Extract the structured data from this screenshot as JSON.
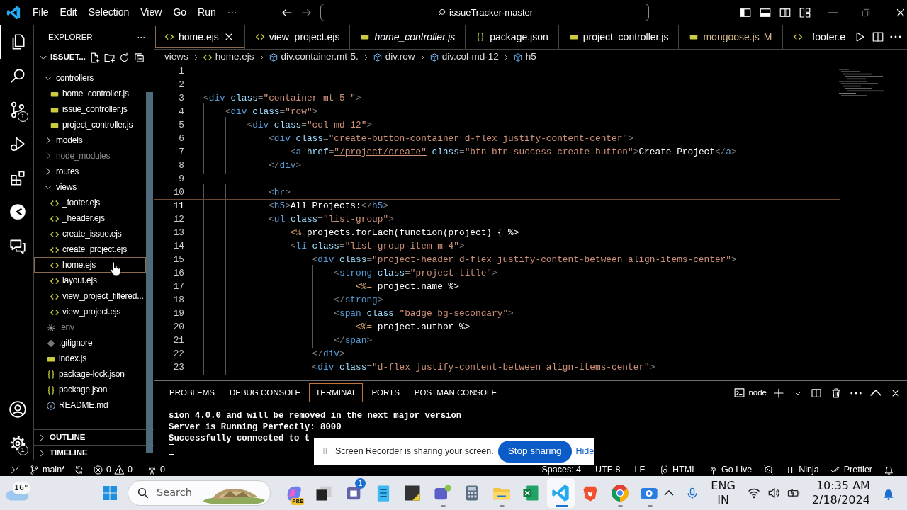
{
  "title_bar": {
    "menus": [
      "File",
      "Edit",
      "Selection",
      "View",
      "Go",
      "Run",
      "···"
    ],
    "command_center": "issueTracker-master"
  },
  "activity_bar": {
    "items": [
      {
        "kind": "files",
        "selected": true
      },
      {
        "kind": "search",
        "selected": false
      },
      {
        "kind": "source-control",
        "selected": false,
        "badge": "1"
      },
      {
        "kind": "run-debug",
        "selected": false
      },
      {
        "kind": "extensions",
        "selected": false
      },
      {
        "kind": "circle-app",
        "selected": false
      },
      {
        "kind": "chat",
        "selected": false
      }
    ],
    "bottom": [
      {
        "kind": "account"
      },
      {
        "kind": "settings",
        "badge": "1"
      }
    ]
  },
  "sidebar": {
    "title": "EXPLORER",
    "more": "···",
    "root": "ISSUET...",
    "tree": [
      {
        "label": "controllers",
        "kind": "folder",
        "expanded": true,
        "ignored": false,
        "selected": false,
        "children": [
          {
            "label": "home_controller.js",
            "kind": "js",
            "ignored": false,
            "selected": false
          },
          {
            "label": "issue_controller.js",
            "kind": "js",
            "ignored": false,
            "selected": false
          },
          {
            "label": "project_controller.js",
            "kind": "js",
            "ignored": false,
            "selected": false
          }
        ]
      },
      {
        "label": "models",
        "kind": "folder",
        "expanded": false,
        "ignored": false,
        "selected": false
      },
      {
        "label": "node_modules",
        "kind": "folder",
        "expanded": false,
        "ignored": true,
        "selected": false
      },
      {
        "label": "routes",
        "kind": "folder",
        "expanded": false,
        "ignored": false,
        "selected": false
      },
      {
        "label": "views",
        "kind": "folder",
        "expanded": true,
        "ignored": false,
        "selected": false,
        "children": [
          {
            "label": "_footer.ejs",
            "kind": "ejs",
            "ignored": false,
            "selected": false
          },
          {
            "label": "_header.ejs",
            "kind": "ejs",
            "ignored": false,
            "selected": false
          },
          {
            "label": "create_issue.ejs",
            "kind": "ejs",
            "ignored": false,
            "selected": false
          },
          {
            "label": "create_project.ejs",
            "kind": "ejs",
            "ignored": false,
            "selected": false
          },
          {
            "label": "home.ejs",
            "kind": "ejs",
            "ignored": false,
            "selected": true
          },
          {
            "label": "layout.ejs",
            "kind": "ejs",
            "ignored": false,
            "selected": false
          },
          {
            "label": "view_project_filtered...",
            "kind": "ejs",
            "ignored": false,
            "selected": false
          },
          {
            "label": "view_project.ejs",
            "kind": "ejs",
            "ignored": false,
            "selected": false
          }
        ]
      },
      {
        "label": ".env",
        "kind": "env",
        "ignored": true,
        "selected": false
      },
      {
        "label": ".gitignore",
        "kind": "git",
        "ignored": false,
        "selected": false
      },
      {
        "label": "index.js",
        "kind": "js",
        "ignored": false,
        "selected": false
      },
      {
        "label": "package-lock.json",
        "kind": "json",
        "ignored": false,
        "selected": false
      },
      {
        "label": "package.json",
        "kind": "json",
        "ignored": false,
        "selected": false
      },
      {
        "label": "README.md",
        "kind": "info",
        "ignored": false,
        "selected": false
      }
    ],
    "sections": [
      {
        "label": "OUTLINE",
        "expanded": false
      },
      {
        "label": "TIMELINE",
        "expanded": false
      }
    ]
  },
  "tabs": [
    {
      "label": "home.ejs",
      "kind": "ejs",
      "selected": true,
      "preview": false
    },
    {
      "label": "view_project.ejs",
      "kind": "ejs",
      "selected": false,
      "preview": false
    },
    {
      "label": "home_controller.js",
      "kind": "js",
      "selected": false,
      "preview": true
    },
    {
      "label": "package.json",
      "kind": "json",
      "selected": false,
      "preview": false
    },
    {
      "label": "project_controller.js",
      "kind": "js",
      "selected": false,
      "preview": false
    },
    {
      "label": "mongoose.js",
      "kind": "js",
      "selected": false,
      "preview": false,
      "status": "M"
    },
    {
      "label": "_footer.e",
      "kind": "ejs",
      "selected": false,
      "preview": false
    }
  ],
  "breadcrumbs": [
    {
      "label": "views",
      "kind": "folder"
    },
    {
      "label": "home.ejs",
      "kind": "ejs"
    },
    {
      "label": "div.container.mt-5.",
      "kind": "element"
    },
    {
      "label": "div.row",
      "kind": "element"
    },
    {
      "label": "div.col-md-12",
      "kind": "element"
    },
    {
      "label": "h5",
      "kind": "element"
    }
  ],
  "code": [
    {
      "number": "1",
      "current": false
    },
    {
      "number": "2",
      "current": false
    },
    {
      "number": "3",
      "current": false,
      "tokens": [
        {
          "kind": "punct",
          "text": "<"
        },
        {
          "kind": "tag",
          "text": "div"
        },
        {
          "kind": "attr",
          "text": " class"
        },
        {
          "kind": "punct",
          "text": "="
        },
        {
          "kind": "str",
          "text": "\"container mt-5 \""
        },
        {
          "kind": "punct",
          "text": ">"
        }
      ]
    },
    {
      "number": "4",
      "current": false,
      "tokens": [
        {
          "kind": "punct",
          "text": "    <"
        },
        {
          "kind": "tag",
          "text": "div"
        },
        {
          "kind": "attr",
          "text": " class"
        },
        {
          "kind": "punct",
          "text": "="
        },
        {
          "kind": "str",
          "text": "\"row\""
        },
        {
          "kind": "punct",
          "text": ">"
        }
      ]
    },
    {
      "number": "5",
      "current": false,
      "tokens": [
        {
          "kind": "punct",
          "text": "        <"
        },
        {
          "kind": "tag",
          "text": "div"
        },
        {
          "kind": "attr",
          "text": " class"
        },
        {
          "kind": "punct",
          "text": "="
        },
        {
          "kind": "str",
          "text": "\"col-md-12\""
        },
        {
          "kind": "punct",
          "text": ">"
        }
      ]
    },
    {
      "number": "6",
      "current": false,
      "tokens": [
        {
          "kind": "punct",
          "text": "            <"
        },
        {
          "kind": "tag",
          "text": "div"
        },
        {
          "kind": "attr",
          "text": " class"
        },
        {
          "kind": "punct",
          "text": "="
        },
        {
          "kind": "str",
          "text": "\"create-button-container d-flex justify-content-center\""
        },
        {
          "kind": "punct",
          "text": ">"
        }
      ]
    },
    {
      "number": "7",
      "current": false,
      "tokens": [
        {
          "kind": "punct",
          "text": "                <"
        },
        {
          "kind": "tag",
          "text": "a"
        },
        {
          "kind": "attr",
          "text": " href"
        },
        {
          "kind": "punct",
          "text": "="
        },
        {
          "kind": "link",
          "text": "\"/project/create\""
        },
        {
          "kind": "attr",
          "text": " class"
        },
        {
          "kind": "punct",
          "text": "="
        },
        {
          "kind": "str",
          "text": "\"btn btn-success create-button\""
        },
        {
          "kind": "punct",
          "text": ">"
        },
        {
          "kind": "text",
          "text": "Create Project"
        },
        {
          "kind": "punct",
          "text": "</"
        },
        {
          "kind": "tag",
          "text": "a"
        },
        {
          "kind": "punct",
          "text": ">"
        }
      ]
    },
    {
      "number": "8",
      "current": false,
      "tokens": [
        {
          "kind": "punct",
          "text": "            </"
        },
        {
          "kind": "tag",
          "text": "div"
        },
        {
          "kind": "punct",
          "text": ">"
        }
      ]
    },
    {
      "number": "9",
      "current": false
    },
    {
      "number": "10",
      "current": false,
      "tokens": [
        {
          "kind": "punct",
          "text": "            <"
        },
        {
          "kind": "tag",
          "text": "hr"
        },
        {
          "kind": "punct",
          "text": ">"
        }
      ]
    },
    {
      "number": "11",
      "current": true,
      "tokens": [
        {
          "kind": "punct",
          "text": "            <"
        },
        {
          "kind": "tag",
          "text": "h5"
        },
        {
          "kind": "punct",
          "text": ">"
        },
        {
          "kind": "text",
          "text": "All Projects:"
        },
        {
          "kind": "punct",
          "text": "</"
        },
        {
          "kind": "tag",
          "text": "h5"
        },
        {
          "kind": "punct",
          "text": ">"
        }
      ]
    },
    {
      "number": "12",
      "current": false,
      "tokens": [
        {
          "kind": "punct",
          "text": "            <"
        },
        {
          "kind": "tag",
          "text": "ul"
        },
        {
          "kind": "attr",
          "text": " class"
        },
        {
          "kind": "punct",
          "text": "="
        },
        {
          "kind": "str",
          "text": "\"list-group\""
        },
        {
          "kind": "punct",
          "text": ">"
        }
      ]
    },
    {
      "number": "13",
      "current": false,
      "tokens": [
        {
          "kind": "ejs",
          "text": "                <%"
        },
        {
          "kind": "text",
          "text": " projects.forEach(function(project) { %>"
        }
      ]
    },
    {
      "number": "14",
      "current": false,
      "tokens": [
        {
          "kind": "punct",
          "text": "                <"
        },
        {
          "kind": "tag",
          "text": "li"
        },
        {
          "kind": "attr",
          "text": " class"
        },
        {
          "kind": "punct",
          "text": "="
        },
        {
          "kind": "str",
          "text": "\"list-group-item m-4\""
        },
        {
          "kind": "punct",
          "text": ">"
        }
      ]
    },
    {
      "number": "15",
      "current": false,
      "tokens": [
        {
          "kind": "punct",
          "text": "                    <"
        },
        {
          "kind": "tag",
          "text": "div"
        },
        {
          "kind": "attr",
          "text": " class"
        },
        {
          "kind": "punct",
          "text": "="
        },
        {
          "kind": "str",
          "text": "\"project-header d-flex justify-content-between align-items-center\""
        },
        {
          "kind": "punct",
          "text": ">"
        }
      ]
    },
    {
      "number": "16",
      "current": false,
      "tokens": [
        {
          "kind": "punct",
          "text": "                        <"
        },
        {
          "kind": "tag",
          "text": "strong"
        },
        {
          "kind": "attr",
          "text": " class"
        },
        {
          "kind": "punct",
          "text": "="
        },
        {
          "kind": "str",
          "text": "\"project-title\""
        },
        {
          "kind": "punct",
          "text": ">"
        }
      ]
    },
    {
      "number": "17",
      "current": false,
      "tokens": [
        {
          "kind": "ejs",
          "text": "                            <%="
        },
        {
          "kind": "text",
          "text": " project.name %>"
        }
      ]
    },
    {
      "number": "18",
      "current": false,
      "tokens": [
        {
          "kind": "punct",
          "text": "                        </"
        },
        {
          "kind": "tag",
          "text": "strong"
        },
        {
          "kind": "punct",
          "text": ">"
        }
      ]
    },
    {
      "number": "19",
      "current": false,
      "tokens": [
        {
          "kind": "punct",
          "text": "                        <"
        },
        {
          "kind": "tag",
          "text": "span"
        },
        {
          "kind": "attr",
          "text": " class"
        },
        {
          "kind": "punct",
          "text": "="
        },
        {
          "kind": "str",
          "text": "\"badge bg-secondary\""
        },
        {
          "kind": "punct",
          "text": ">"
        }
      ]
    },
    {
      "number": "20",
      "current": false,
      "tokens": [
        {
          "kind": "ejs",
          "text": "                            <%="
        },
        {
          "kind": "text",
          "text": " project.author %>"
        }
      ]
    },
    {
      "number": "21",
      "current": false,
      "tokens": [
        {
          "kind": "punct",
          "text": "                        </"
        },
        {
          "kind": "tag",
          "text": "span"
        },
        {
          "kind": "punct",
          "text": ">"
        }
      ]
    },
    {
      "number": "22",
      "current": false,
      "tokens": [
        {
          "kind": "punct",
          "text": "                    </"
        },
        {
          "kind": "tag",
          "text": "div"
        },
        {
          "kind": "punct",
          "text": ">"
        }
      ]
    },
    {
      "number": "23",
      "current": false,
      "tokens": [
        {
          "kind": "punct",
          "text": "                    <"
        },
        {
          "kind": "tag",
          "text": "div"
        },
        {
          "kind": "attr",
          "text": " class"
        },
        {
          "kind": "punct",
          "text": "="
        },
        {
          "kind": "str",
          "text": "\"d-flex justify-content-between align-items-center\""
        },
        {
          "kind": "punct",
          "text": ">"
        }
      ]
    }
  ],
  "panel": {
    "tabs": [
      {
        "label": "PROBLEMS",
        "selected": false
      },
      {
        "label": "DEBUG CONSOLE",
        "selected": false
      },
      {
        "label": "TERMINAL",
        "selected": true
      },
      {
        "label": "PORTS",
        "selected": false
      },
      {
        "label": "POSTMAN CONSOLE",
        "selected": false
      }
    ],
    "terminal_name": "node",
    "terminal_lines": [
      "sion 4.0.0 and will be removed in the next major version",
      "Server is Running Perfectly: 8000",
      "Successfully connected to t"
    ]
  },
  "share_popup": {
    "message": "Screen Recorder is sharing your screen.",
    "stop": "Stop sharing",
    "hide": "Hide"
  },
  "status_bar": {
    "branch": "main*",
    "errors": "0",
    "warnings": "0",
    "ports": "0",
    "right": [
      {
        "kind": "text",
        "label": "Spaces: 4"
      },
      {
        "kind": "text",
        "label": "UTF-8"
      },
      {
        "kind": "text",
        "label": "LF"
      },
      {
        "kind": "braces",
        "label": "HTML"
      },
      {
        "kind": "broadcast",
        "label": "Go Live"
      },
      {
        "kind": "copilot-off"
      },
      {
        "kind": "pause",
        "label": "Ninja"
      },
      {
        "kind": "checks",
        "label": "Prettier"
      },
      {
        "kind": "bell"
      }
    ]
  },
  "taskbar": {
    "weather": "16°",
    "search": "Search",
    "apps": [
      {
        "kind": "copilot",
        "badge": "PRE",
        "running": false,
        "active": false
      },
      {
        "kind": "task-view",
        "running": false,
        "active": false
      },
      {
        "kind": "teams",
        "badge": "1",
        "running": false,
        "active": false
      },
      {
        "kind": "notepad",
        "running": false,
        "active": false
      },
      {
        "kind": "sticky",
        "running": false,
        "active": false
      },
      {
        "kind": "teams-work",
        "running": true,
        "active": false
      },
      {
        "kind": "calculator",
        "running": false,
        "active": false
      },
      {
        "kind": "folder",
        "running": true,
        "active": false
      },
      {
        "kind": "excel",
        "running": false,
        "active": false
      },
      {
        "kind": "vscode",
        "running": true,
        "active": true
      },
      {
        "kind": "brave",
        "running": false,
        "active": false
      },
      {
        "kind": "chrome",
        "running": true,
        "active": false
      },
      {
        "kind": "camera",
        "running": true,
        "active": false
      }
    ],
    "language": [
      "ENG",
      "IN"
    ],
    "time": "10:35 AM",
    "date": "2/18/2024"
  }
}
